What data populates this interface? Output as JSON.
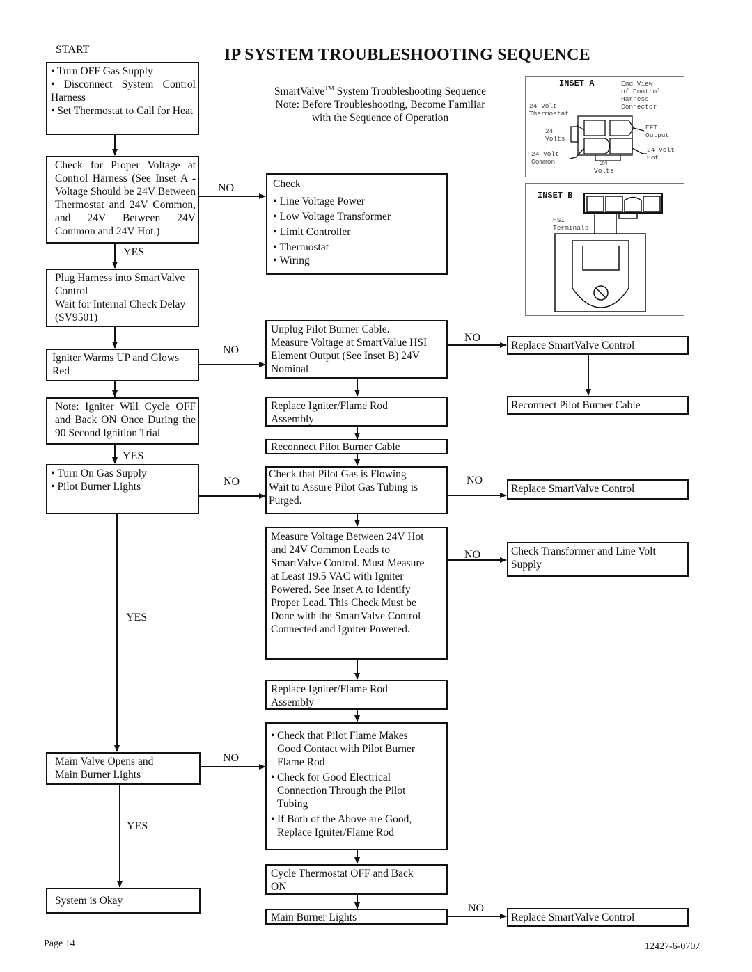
{
  "title": "IP SYSTEM TROUBLESHOOTING SEQUENCE",
  "subtitle": {
    "brand": "SmartValve",
    "tm": "TM",
    "line1_rest": " System Troubleshooting Sequence",
    "line2": "Note: Before Troubleshooting, Become Familiar",
    "line3": "with the Sequence of Operation"
  },
  "labels": {
    "start": "START",
    "yes": "YES",
    "no": "NO"
  },
  "left_column": {
    "start_box": [
      "• Turn OFF Gas Supply",
      "• Disconnect System Control Harness",
      "• Set Thermostat to Call for Heat"
    ],
    "voltage_check": "Check for Proper Voltage at Control Harness (See Inset A - Voltage Should be 24V Between Thermostat and 24V Common, and 24V Between 24V Common and 24V Hot.)",
    "plug_harness": [
      "Plug Harness into SmartValve Control",
      "Wait for Internal Check Delay (SV9501)"
    ],
    "igniter_warms": "Igniter Warms UP and Glows Red",
    "igniter_note": "Note: Igniter Will Cycle OFF and Back ON Once During the 90 Second Ignition Trial",
    "gas_supply": [
      "Turn On Gas Supply",
      "Pilot Burner Lights"
    ],
    "main_valve": [
      "Main Valve Opens and",
      "Main Burner Lights"
    ],
    "system_okay": "System is Okay"
  },
  "middle_column": {
    "check_title": "Check",
    "check_items": [
      "Line Voltage Power",
      "Low Voltage Transformer",
      "Limit Controller",
      "Thermostat",
      "Wiring"
    ],
    "unplug": [
      "Unplug Pilot Burner Cable.",
      "Measure Voltage at SmartValue HSI",
      "Element Output (See Inset B) 24V",
      "Nominal"
    ],
    "replace_igniter_1": [
      "Replace Igniter/Flame Rod",
      "Assembly"
    ],
    "reconnect_cable": "Reconnect Pilot Burner Cable",
    "pilot_gas": [
      "Check that Pilot Gas is Flowing",
      "Wait to Assure Pilot Gas Tubing is",
      "Purged."
    ],
    "measure_voltage": [
      "Measure Voltage Between 24V Hot",
      "and 24V Common Leads to",
      "SmartValve Control. Must Measure",
      "at Least 19.5 VAC with Igniter",
      "Powered. See Inset A to Identify",
      "Proper Lead. This Check Must be",
      "Done with the SmartValve Control",
      "Connected and Igniter Powered."
    ],
    "replace_igniter_2": [
      "Replace Igniter/Flame Rod",
      "Assembly"
    ],
    "flame_checks": [
      [
        "Check that Pilot Flame Makes",
        "Good Contact with Pilot Burner",
        "Flame Rod"
      ],
      [
        "Check for Good Electrical",
        "Connection Through the Pilot",
        "Tubing"
      ],
      [
        "If Both of the Above are Good,",
        "Replace Igniter/Flame Rod"
      ]
    ],
    "cycle_thermostat": [
      "Cycle Thermostat OFF and Back",
      "ON"
    ],
    "main_burner_lights": "Main Burner Lights"
  },
  "right_column": {
    "replace_control_1": "Replace SmartValve Control",
    "reconnect_cable": "Reconnect Pilot Burner Cable",
    "replace_control_2": "Replace SmartValve Control",
    "check_transformer": [
      "Check Transformer and Line Volt",
      "Supply"
    ],
    "replace_control_3": "Replace SmartValve Control"
  },
  "inset_a": {
    "title": "INSET A",
    "caption": [
      "End View",
      "of Control",
      "Harness",
      "Connector"
    ],
    "thermostat": [
      "24 Volt",
      "Thermostat"
    ],
    "volts_left": [
      "24",
      "Volts"
    ],
    "common": [
      "24 Volt",
      "Common"
    ],
    "eft": [
      "EFT",
      "Output"
    ],
    "hot": [
      "24 Volt",
      "Hot"
    ],
    "volts_bottom": [
      "24",
      "Volts"
    ]
  },
  "inset_b": {
    "title": "INSET B",
    "hsi": [
      "HSI",
      "Terminals"
    ]
  },
  "footer": {
    "page": "Page 14",
    "doc_number": "12427-6-0707"
  }
}
